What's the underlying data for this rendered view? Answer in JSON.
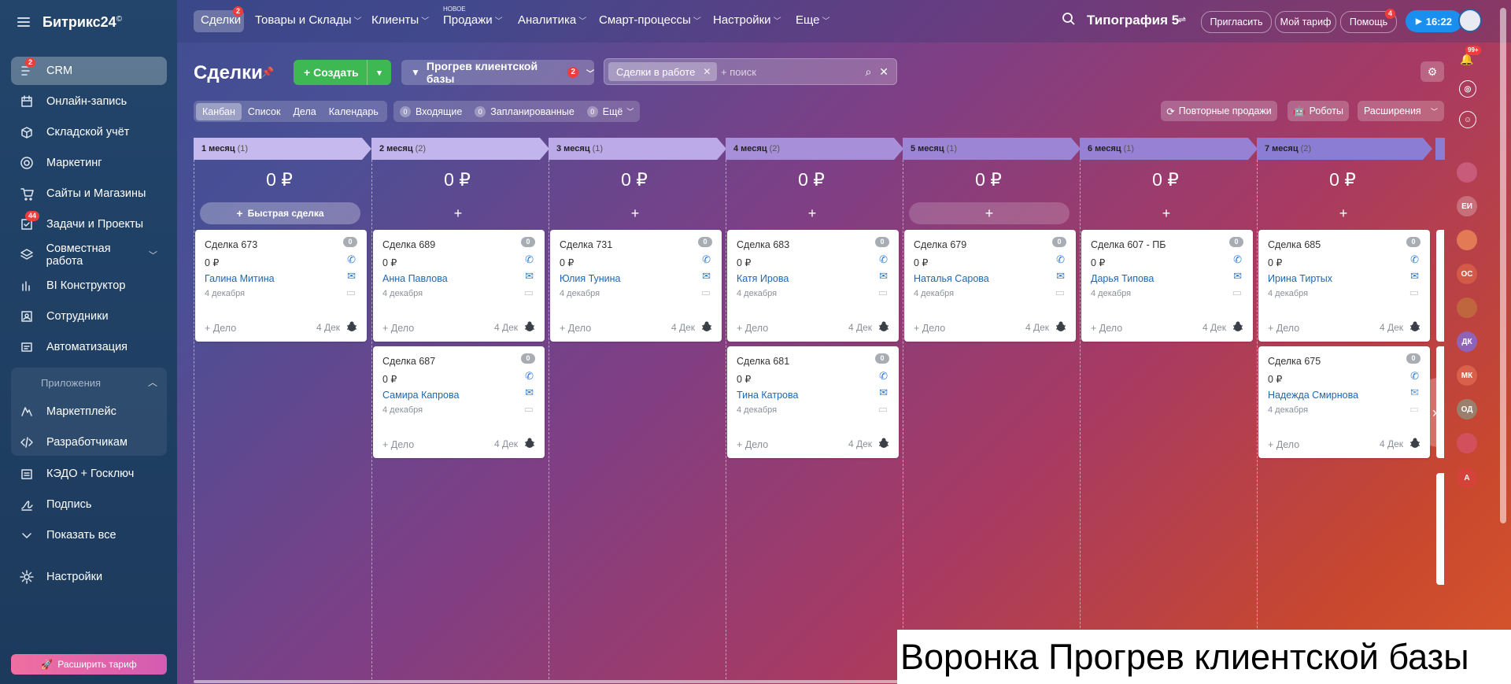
{
  "sidebar": {
    "logo": "Битрикс24",
    "logo_mark": "©",
    "items": [
      {
        "label": "CRM",
        "badge": "2",
        "icon": "crm-icon"
      },
      {
        "label": "Онлайн-запись",
        "icon": "calendar-icon"
      },
      {
        "label": "Складской учёт",
        "icon": "box-icon"
      },
      {
        "label": "Маркетинг",
        "icon": "target-icon"
      },
      {
        "label": "Сайты и Магазины",
        "icon": "cart-icon"
      },
      {
        "label": "Задачи и Проекты",
        "badge": "44",
        "icon": "tasks-icon"
      },
      {
        "label": "Совместная работа",
        "icon": "collab-icon"
      },
      {
        "label": "BI Конструктор",
        "icon": "bar-chart-icon"
      },
      {
        "label": "Сотрудники",
        "icon": "employees-icon"
      },
      {
        "label": "Автоматизация",
        "icon": "automation-icon"
      }
    ],
    "apps_title": "Приложения",
    "apps_items": [
      {
        "label": "Маркетплейс",
        "icon": "marketplace-icon"
      },
      {
        "label": "Разработчикам",
        "icon": "code-icon"
      }
    ],
    "bottom_items": [
      {
        "label": "КЭДО + Госключ",
        "icon": "document-icon"
      },
      {
        "label": "Подпись",
        "icon": "signature-icon"
      },
      {
        "label": "Показать все",
        "icon": "chevron-down-icon"
      },
      {
        "label": "Настройки",
        "icon": "gear-icon"
      }
    ],
    "expand_tariff": "Расширить тариф"
  },
  "topbar": {
    "nav": [
      {
        "label": "Сделки",
        "badge": "2"
      },
      {
        "label": "Товары и Склады"
      },
      {
        "label": "Клиенты"
      },
      {
        "label": "Продажи",
        "tag": "НОВОЕ"
      },
      {
        "label": "Аналитика"
      },
      {
        "label": "Смарт-процессы"
      },
      {
        "label": "Настройки"
      },
      {
        "label": "Еще"
      }
    ],
    "company": "Типография 5",
    "invite": "Пригласить",
    "my_tariff": "Мой тариф",
    "help": "Помощь",
    "help_badge": "4",
    "time": "16:22"
  },
  "page": {
    "title": "Сделки",
    "create": "Создать",
    "funnel": "Прогрев клиентской базы",
    "funnel_badge": "2",
    "filter_chip": "Сделки в работе",
    "search_placeholder": "+ поиск",
    "view_tabs": [
      "Канбан",
      "Список",
      "Дела",
      "Календарь"
    ],
    "counters": [
      {
        "num": "0",
        "label": "Входящие"
      },
      {
        "num": "0",
        "label": "Запланированные"
      },
      {
        "num": "0",
        "label": "Ещё"
      }
    ],
    "repeat_sales": "Повторные продажи",
    "robots": "Роботы",
    "extensions": "Расширения",
    "quick_deal": "Быстрая сделка"
  },
  "kanban": {
    "columns": [
      {
        "name": "1 месяц",
        "count": "(1)",
        "total": "0 ₽",
        "color": "#c6b9ee"
      },
      {
        "name": "2 месяц",
        "count": "(2)",
        "total": "0 ₽",
        "color": "#c2b4ec"
      },
      {
        "name": "3 месяц",
        "count": "(1)",
        "total": "0 ₽",
        "color": "#bba9e8"
      },
      {
        "name": "4 месяц",
        "count": "(2)",
        "total": "0 ₽",
        "color": "#a88fd9"
      },
      {
        "name": "5 месяц",
        "count": "(1)",
        "total": "0 ₽",
        "color": "#9d85d6"
      },
      {
        "name": "6 месяц",
        "count": "(1)",
        "total": "0 ₽",
        "color": "#9681d4"
      },
      {
        "name": "7 месяц",
        "count": "(2)",
        "total": "0 ₽",
        "color": "#8a7dd3"
      }
    ],
    "cards": [
      {
        "col": 0,
        "row": 0,
        "title": "Сделка 673",
        "sum": "0 ₽",
        "contact": "Галина Митина",
        "date": "4 декабря",
        "task": "+ Дело",
        "task_date": "4 Дек",
        "badge": "0"
      },
      {
        "col": 1,
        "row": 0,
        "title": "Сделка 689",
        "sum": "0 ₽",
        "contact": "Анна Павлова",
        "date": "4 декабря",
        "task": "+ Дело",
        "task_date": "4 Дек",
        "badge": "0"
      },
      {
        "col": 1,
        "row": 1,
        "title": "Сделка 687",
        "sum": "0 ₽",
        "contact": "Самира Капрова",
        "date": "4 декабря",
        "task": "+ Дело",
        "task_date": "4 Дек",
        "badge": "0"
      },
      {
        "col": 2,
        "row": 0,
        "title": "Сделка 731",
        "sum": "0 ₽",
        "contact": "Юлия Тунина",
        "date": "4 декабря",
        "task": "+ Дело",
        "task_date": "4 Дек",
        "badge": "0"
      },
      {
        "col": 3,
        "row": 0,
        "title": "Сделка 683",
        "sum": "0 ₽",
        "contact": "Катя Ирова",
        "date": "4 декабря",
        "task": "+ Дело",
        "task_date": "4 Дек",
        "badge": "0"
      },
      {
        "col": 3,
        "row": 1,
        "title": "Сделка 681",
        "sum": "0 ₽",
        "contact": "Тина Катрова",
        "date": "4 декабря",
        "task": "+ Дело",
        "task_date": "4 Дек",
        "badge": "0"
      },
      {
        "col": 4,
        "row": 0,
        "title": "Сделка 679",
        "sum": "0 ₽",
        "contact": "Наталья Сарова",
        "date": "4 декабря",
        "task": "+ Дело",
        "task_date": "4 Дек",
        "badge": "0"
      },
      {
        "col": 5,
        "row": 0,
        "title": "Сделка 607 - ПБ",
        "sum": "0 ₽",
        "contact": "Дарья Типова",
        "date": "4 декабря",
        "task": "+ Дело",
        "task_date": "4 Дек",
        "badge": "0"
      },
      {
        "col": 6,
        "row": 0,
        "title": "Сделка 685",
        "sum": "0 ₽",
        "contact": "Ирина Тиртых",
        "date": "4 декабря",
        "task": "+ Дело",
        "task_date": "4 Дек",
        "badge": "0"
      },
      {
        "col": 6,
        "row": 1,
        "title": "Сделка 675",
        "sum": "0 ₽",
        "contact": "Надежда Смирнова",
        "date": "4 декабря",
        "task": "+ Дело",
        "task_date": "4 Дек",
        "badge": "0"
      }
    ]
  },
  "rail": {
    "notif_badge": "99+",
    "avatars": [
      "ЕИ",
      "ОС",
      "ДК",
      "МК",
      "ОД",
      "А"
    ]
  },
  "caption": "Воронка Прогрев клиентской базы"
}
